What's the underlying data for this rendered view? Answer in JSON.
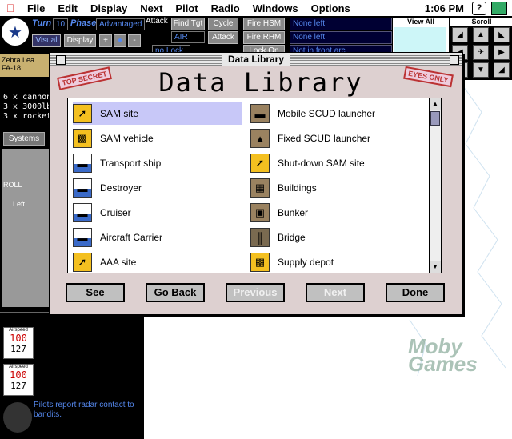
{
  "menubar": {
    "items": [
      "File",
      "Edit",
      "Display",
      "Next",
      "Pilot",
      "Radio",
      "Windows",
      "Options"
    ],
    "clock": "1:06 PM",
    "help": "?"
  },
  "dashboard": {
    "turn_label": "Turn",
    "turn_value": "10",
    "phase_label": "Phase",
    "phase_value": "Advantaged",
    "visual_btn": "Visual",
    "display_btn": "Display",
    "plus_btn": "+",
    "minus_btn": "-",
    "attack_label": "Attack",
    "find_tgt": "Find Tgt",
    "cycle": "Cycle",
    "fire_hsm": "Fire HSM",
    "air": "AIR",
    "attack_btn": "Attack",
    "fire_rhm": "Fire RHM",
    "no_lock": "no Lock",
    "lock_on": "Lock On",
    "status1": "None left",
    "status2": "None left",
    "status3": "Not in front arc"
  },
  "view_all": {
    "title": "View All"
  },
  "scroll": {
    "title": "Scroll"
  },
  "left": {
    "aircraft_name": "Zebra Lea",
    "aircraft_type": "FA-18",
    "loadout": [
      "6 x cannon",
      "3 x 3000lb.",
      "3 x rocket"
    ],
    "systems": "Systems",
    "roll": "ROLL",
    "left": "Left",
    "airspeed_label": "Airspeed",
    "airspeed1": "127",
    "airspeed1_red": "100",
    "airspeed2": "127",
    "airspeed2_red": "100",
    "message": "Pilots report radar contact to bandits."
  },
  "window": {
    "title": "Data Library",
    "heading": "Data Library",
    "stamp_left": "TOP SECRET",
    "stamp_right": "EYES ONLY"
  },
  "items_left": [
    "SAM site",
    "SAM vehicle",
    "Transport ship",
    "Destroyer",
    "Cruiser",
    "Aircraft Carrier",
    "AAA site"
  ],
  "items_right": [
    "Mobile SCUD launcher",
    "Fixed SCUD launcher",
    "Shut-down SAM site",
    "Buildings",
    "Bunker",
    "Bridge",
    "Supply depot"
  ],
  "icons_left": [
    "missile-icon",
    "sam-vehicle-icon",
    "transport-ship-icon",
    "destroyer-icon",
    "cruiser-icon",
    "carrier-icon",
    "aaa-icon"
  ],
  "icons_right": [
    "scud-truck-icon",
    "scud-fixed-icon",
    "broken-missile-icon",
    "buildings-icon",
    "bunker-icon",
    "bridge-icon",
    "oil-drum-icon"
  ],
  "selected": "SAM site",
  "buttons": {
    "see": "See",
    "go_back": "Go Back",
    "previous": "Previous",
    "next": "Next",
    "done": "Done"
  },
  "watermark": "Moby Games",
  "colors": {
    "selection": "#c8c8f8",
    "window_bg": "#ddd0d0",
    "stamp": "#b33333",
    "dashboard_text": "#5588ee"
  }
}
